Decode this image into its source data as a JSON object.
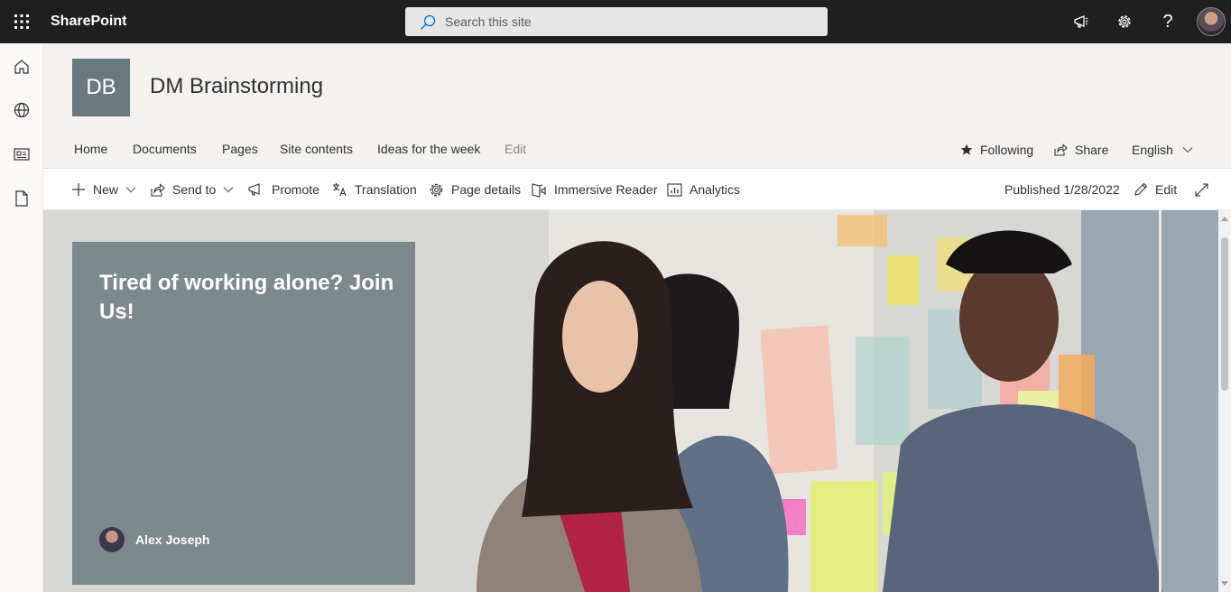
{
  "app": {
    "name": "SharePoint"
  },
  "search": {
    "placeholder": "Search this site"
  },
  "site": {
    "logo_initials": "DB",
    "title": "DM Brainstorming",
    "logo_color": "#69797e"
  },
  "nav": {
    "links": [
      "Home",
      "Documents",
      "Pages",
      "Site contents",
      "Ideas for the week",
      "Edit"
    ],
    "following": "Following",
    "share": "Share",
    "language": "English"
  },
  "commandbar": {
    "new": "New",
    "send_to": "Send to",
    "promote": "Promote",
    "translation": "Translation",
    "page_details": "Page details",
    "immersive_reader": "Immersive Reader",
    "analytics": "Analytics",
    "published": "Published 1/28/2022",
    "edit": "Edit"
  },
  "hero": {
    "title": "Tired of working alone? Join Us!",
    "author": "Alex Joseph"
  },
  "icons": {
    "waffle": "waffle-icon",
    "search": "search-icon",
    "megaphone": "megaphone-icon",
    "settings": "gear-icon",
    "help": "help-icon",
    "home": "home-icon",
    "globe": "globe-icon",
    "news": "news-icon",
    "document": "document-icon"
  }
}
